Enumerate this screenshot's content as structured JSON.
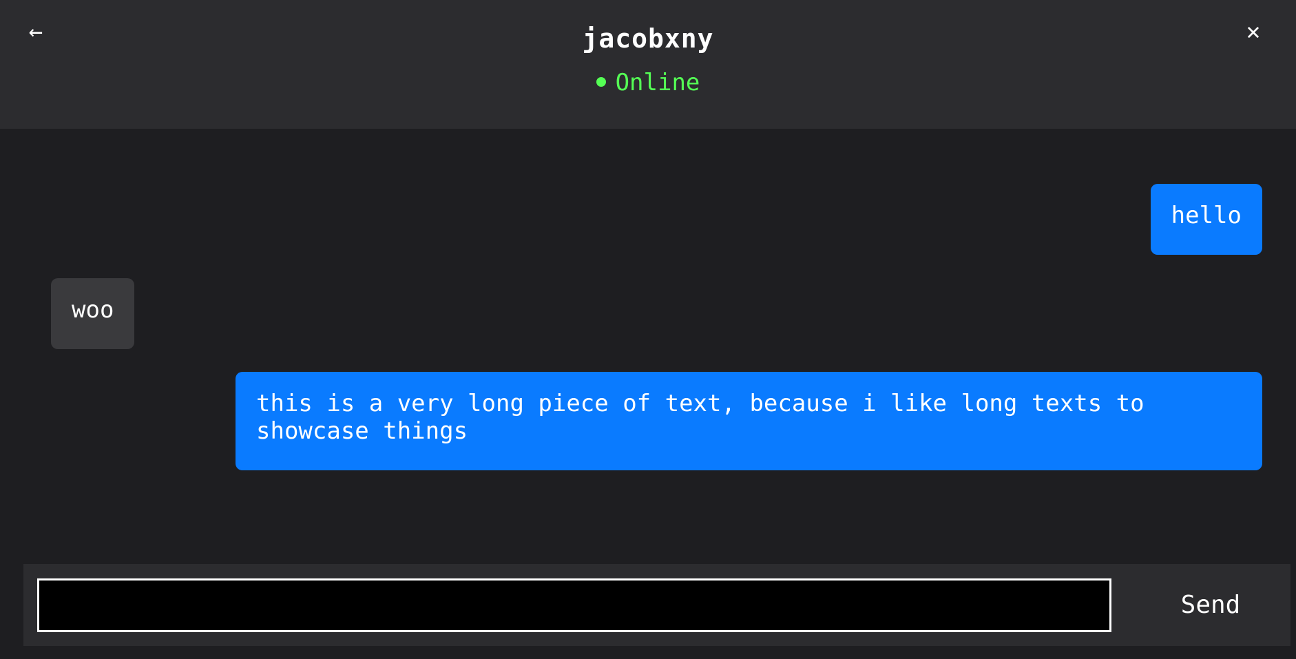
{
  "header": {
    "back_icon": "←",
    "close_icon": "✕",
    "title": "jacobxny",
    "status": "Online",
    "status_color": "#55ff55"
  },
  "messages": [
    {
      "sender": "self",
      "text": "hello"
    },
    {
      "sender": "other",
      "text": "woo"
    },
    {
      "sender": "self",
      "text": "this is a very long piece of text, because i like long texts to showcase things"
    }
  ],
  "composer": {
    "input_value": "",
    "input_placeholder": "",
    "send_label": "Send"
  },
  "colors": {
    "sent_bubble": "#0a7bff",
    "received_bubble": "#3a3a3d",
    "background": "#1e1e21",
    "header": "#2c2c2f"
  }
}
